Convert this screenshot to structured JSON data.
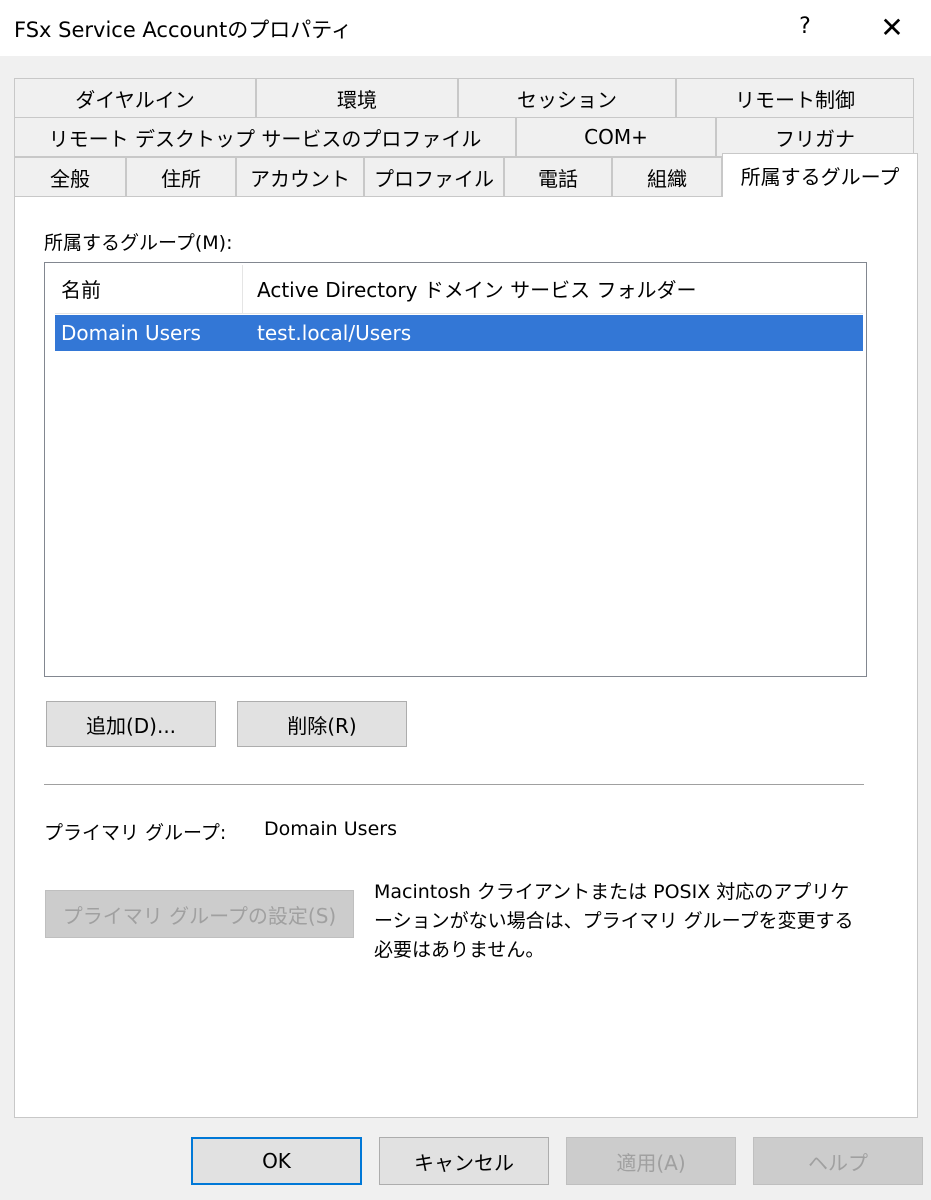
{
  "window": {
    "title": "FSx Service Accountのプロパティ",
    "help_label": "?",
    "close_label": "✕"
  },
  "tabs": {
    "row1": [
      "ダイヤルイン",
      "環境",
      "セッション",
      "リモート制御"
    ],
    "row2": [
      "リモート デスクトップ サービスのプロファイル",
      "COM+",
      "フリガナ"
    ],
    "row3": [
      "全般",
      "住所",
      "アカウント",
      "プロファイル",
      "電話",
      "組織",
      "所属するグループ"
    ],
    "active": "所属するグループ"
  },
  "groups": {
    "label": "所属するグループ(M):",
    "columns": [
      "名前",
      "Active Directory ドメイン サービス フォルダー"
    ],
    "rows": [
      {
        "name": "Domain Users",
        "folder": "test.local/Users",
        "selected": true
      }
    ],
    "add_button": "追加(D)...",
    "remove_button": "削除(R)"
  },
  "primary_group": {
    "label": "プライマリ グループ:",
    "value": "Domain Users",
    "set_button": "プライマリ グループの設定(S)",
    "note_lines": [
      "Macintosh クライアントまたは POSIX 対応のアプリケ",
      "ーションがない場合は、プライマリ グループを変更する",
      "必要はありません。"
    ]
  },
  "footer": {
    "ok": "OK",
    "cancel": "キャンセル",
    "apply": "適用(A)",
    "help": "ヘルプ"
  },
  "colors": {
    "selection": "#3377d6",
    "dialog_background": "#f0f0f0",
    "default_button_border": "#0078d7"
  }
}
